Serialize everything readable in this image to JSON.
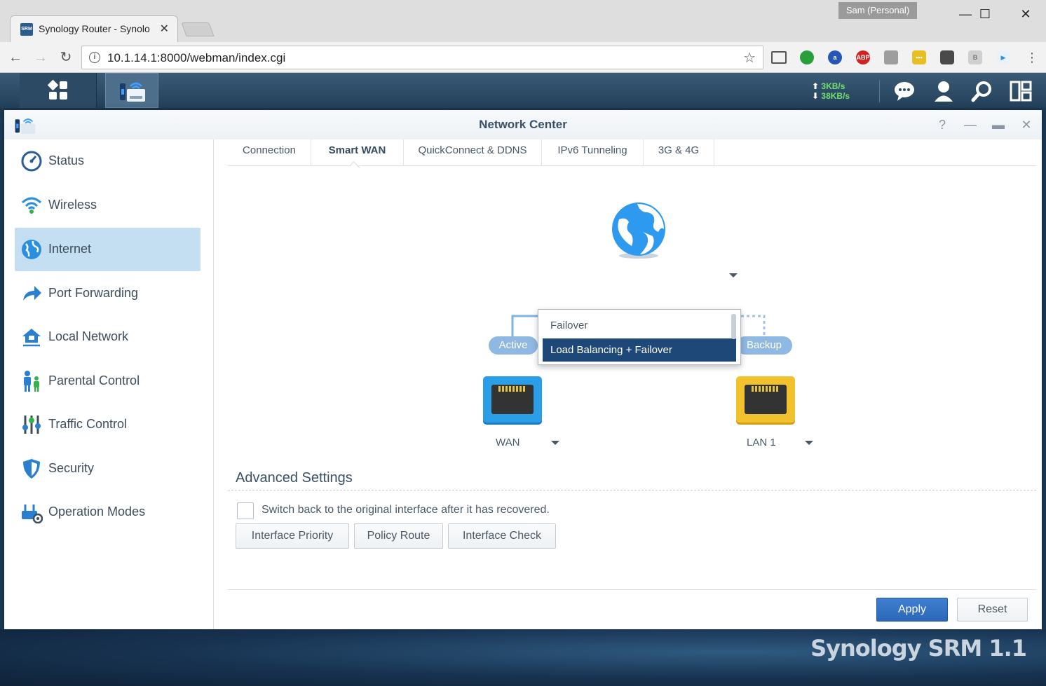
{
  "browser": {
    "tab_title": "Synology Router - Synolo",
    "tab_favicon_text": "SRM",
    "profile": "Sam (Personal)",
    "url": "10.1.14.1:8000/webman/index.cgi"
  },
  "taskbar": {
    "upload_speed": "3KB/s",
    "download_speed": "38KB/s"
  },
  "window": {
    "title": "Network Center"
  },
  "sidebar": {
    "items": [
      {
        "label": "Status"
      },
      {
        "label": "Wireless"
      },
      {
        "label": "Internet"
      },
      {
        "label": "Port Forwarding"
      },
      {
        "label": "Local Network"
      },
      {
        "label": "Parental Control"
      },
      {
        "label": "Traffic Control"
      },
      {
        "label": "Security"
      },
      {
        "label": "Operation Modes"
      }
    ],
    "active_index": 2
  },
  "tabs": [
    "Connection",
    "Smart WAN",
    "QuickConnect & DDNS",
    "IPv6 Tunneling",
    "3G & 4G"
  ],
  "diagram": {
    "mode_options": [
      "Failover",
      "Load Balancing + Failover"
    ],
    "selected_mode": "Load Balancing + Failover",
    "active_label": "Active",
    "backup_label": "Backup",
    "interface1": "WAN",
    "interface2": "LAN 1"
  },
  "advanced": {
    "title": "Advanced Settings",
    "switch_back_label": "Switch back to the original interface after it has recovered.",
    "switch_back_checked": false,
    "buttons": [
      "Interface Priority",
      "Policy Route",
      "Interface Check"
    ]
  },
  "footer": {
    "apply": "Apply",
    "reset": "Reset"
  },
  "branding": {
    "text": "Synology SRM 1.1"
  },
  "colors": {
    "accent": "#2b67b8",
    "selection": "#1e4878",
    "wan_port": "#2b9ee8",
    "lan_port": "#f2c12e"
  }
}
